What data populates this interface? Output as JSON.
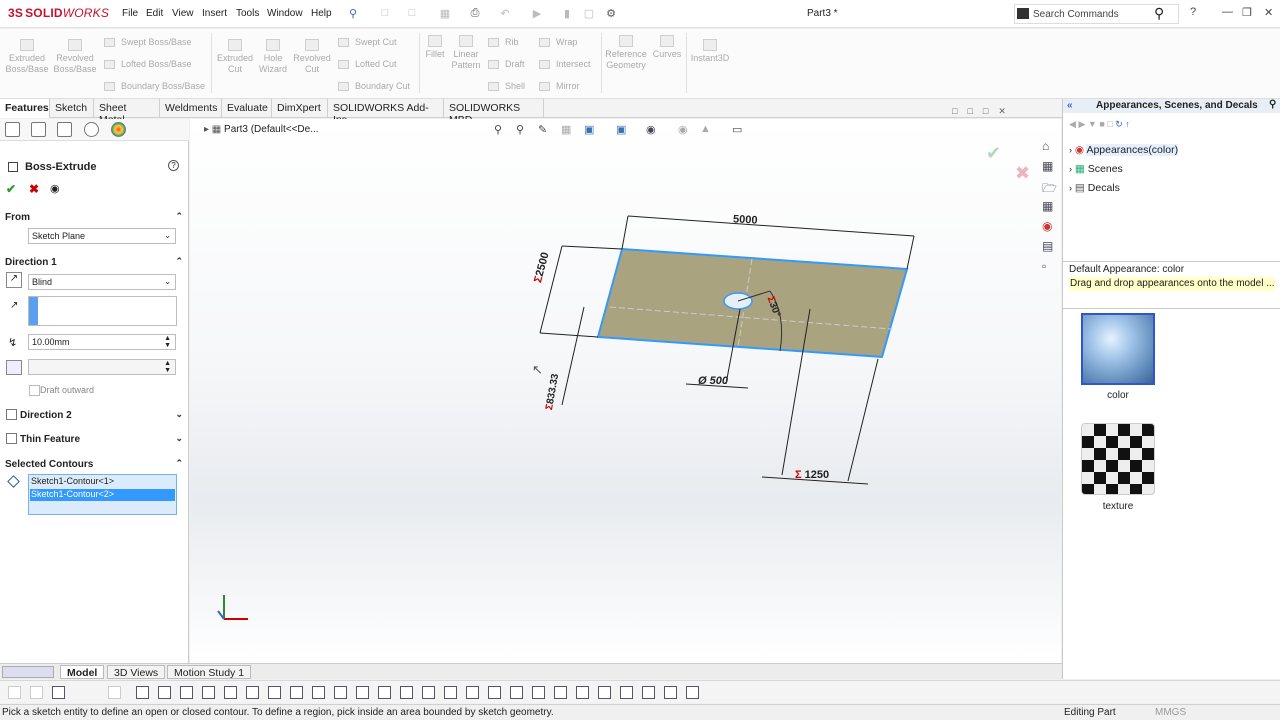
{
  "app": {
    "brand_prefix": "3S",
    "brand_solid": "SOLID",
    "brand_works": "WORKS",
    "document_title": "Part3 *"
  },
  "menu": [
    "File",
    "Edit",
    "View",
    "Insert",
    "Tools",
    "Window",
    "Help"
  ],
  "search": {
    "placeholder": "Search Commands"
  },
  "ribbon": {
    "big": [
      {
        "label": "Extruded Boss/Base"
      },
      {
        "label": "Revolved Boss/Base"
      },
      {
        "label": "Extruded Cut"
      },
      {
        "label": "Hole Wizard"
      },
      {
        "label": "Revolved Cut"
      },
      {
        "label": "Fillet"
      },
      {
        "label": "Linear Pattern"
      },
      {
        "label": "Reference Geometry"
      },
      {
        "label": "Curves"
      },
      {
        "label": "Instant3D"
      }
    ],
    "small_col1": [
      "Swept Boss/Base",
      "Lofted Boss/Base",
      "Boundary Boss/Base"
    ],
    "small_col2": [
      "Swept Cut",
      "Lofted Cut",
      "Boundary Cut"
    ],
    "small_col3": [
      "Rib",
      "Draft",
      "Shell"
    ],
    "small_col4": [
      "Wrap",
      "Intersect",
      "Mirror"
    ]
  },
  "tabs": [
    "Features",
    "Sketch",
    "Sheet Metal",
    "Weldments",
    "Evaluate",
    "DimXpert",
    "SOLIDWORKS Add-Ins",
    "SOLIDWORKS MBD"
  ],
  "property_manager": {
    "feature": "Boss-Extrude",
    "from": {
      "title": "From",
      "value": "Sketch Plane"
    },
    "direction1": {
      "title": "Direction 1",
      "end_condition": "Blind",
      "depth": "10.00mm",
      "draft_outward": "Draft outward"
    },
    "direction2": {
      "title": "Direction 2"
    },
    "thin_feature": {
      "title": "Thin Feature"
    },
    "selected_contours": {
      "title": "Selected Contours",
      "items": [
        "Sketch1-Contour<1>",
        "Sketch1-Contour<2>"
      ]
    }
  },
  "viewport": {
    "tree_label": "Part3  (Default<<De...",
    "dimensions": {
      "width": "5000",
      "depth": "2500",
      "hole": "Ø 500",
      "hole_offset": "833.33",
      "side": "1250",
      "angle": "30°"
    }
  },
  "bottom_tabs": [
    "Model",
    "3D Views",
    "Motion Study 1"
  ],
  "status": {
    "message": "Pick a sketch entity to define an open or closed contour. To define a region, pick inside an area bounded by sketch geometry.",
    "mode": "Editing Part",
    "units": "MMGS"
  },
  "task_pane": {
    "title": "Appearances, Scenes, and Decals",
    "tree": [
      "Appearances(color)",
      "Scenes",
      "Decals"
    ],
    "default_appearance": "Default Appearance: color",
    "hint": "Drag and drop appearances onto the model ...",
    "thumbs": [
      "color",
      "texture"
    ]
  },
  "colors": {
    "accent": "#3d8ee0",
    "face": "#a9a380",
    "selection": "#3399ff",
    "hint_bg": "#ffffc8",
    "dim_red": "#cc0000"
  }
}
